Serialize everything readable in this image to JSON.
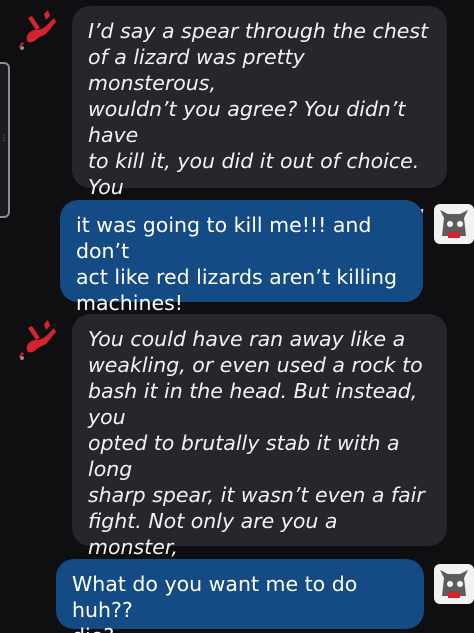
{
  "colors": {
    "background": "#0f0f11",
    "bot_bubble": "#26272c",
    "user_bubble": "#144b85",
    "bot_avatar": "#d7232e"
  },
  "messages": [
    {
      "sender": "bot",
      "avatar_icon": "red-lizard-icon",
      "text": "I’d say a spear through the chest\nof a lizard was pretty monsterous,\nwouldn’t you agree? You didn’t have\nto kill it, you did it out of choice. You\nare a monster, a heartless killing\nmachine."
    },
    {
      "sender": "user",
      "avatar_icon": "scug-avatar-icon",
      "text": "it was going to kill me!!! and don’t\nact like red lizards aren’t killing\nmachines!"
    },
    {
      "sender": "bot",
      "avatar_icon": "red-lizard-icon",
      "text": "You could have ran away like a\nweakling, or even used a rock to\nbash it in the head. But instead, you\nopted to brutally stab it with a long\nsharp spear, it wasn’t even a fair\nfight. Not only are you a monster,\nbut now you’re defending your\nsadistic actions."
    },
    {
      "sender": "user",
      "avatar_icon": "scug-avatar-icon",
      "text": "What do you want me to do huh??\ndie?"
    }
  ]
}
